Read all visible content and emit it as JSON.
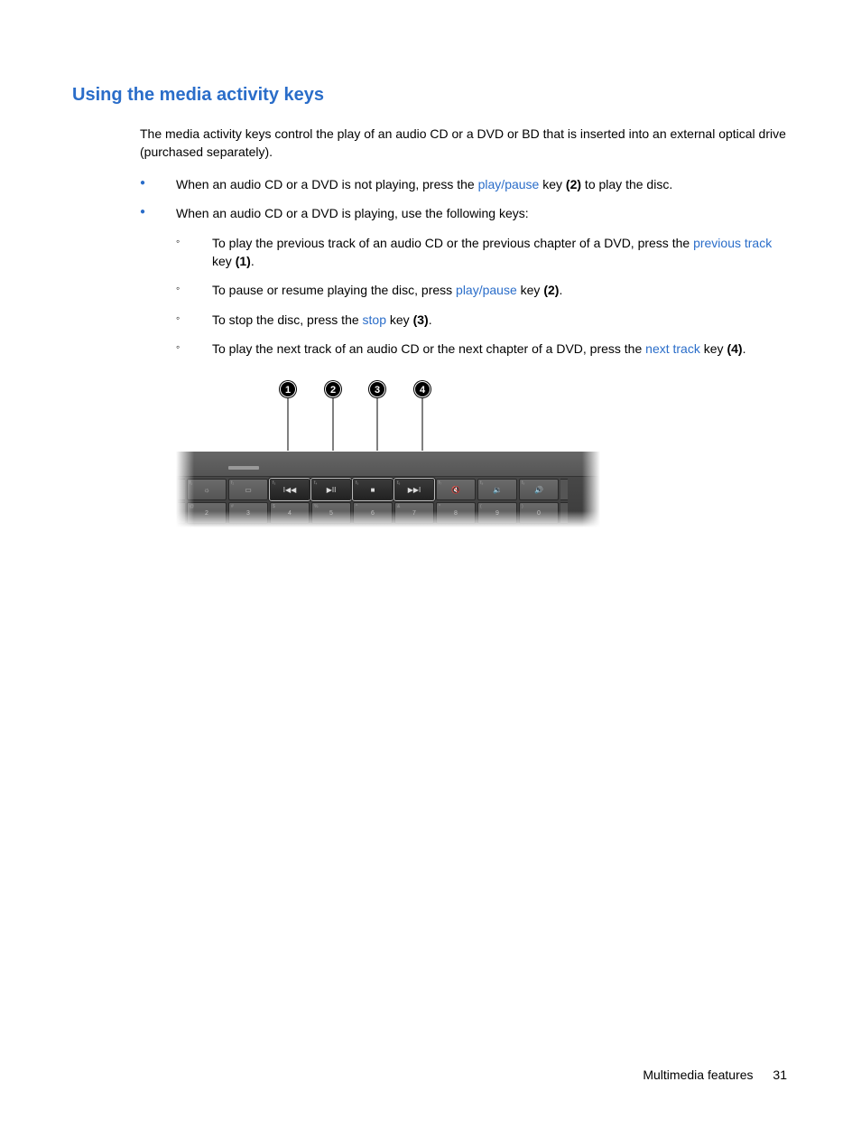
{
  "heading": "Using the media activity keys",
  "intro": "The media activity keys control the play of an audio CD or a DVD or BD that is inserted into an external optical drive (purchased separately).",
  "bullet1": {
    "pre": "When an audio CD or a DVD is not playing, press the ",
    "link": "play/pause",
    "post_a": " key ",
    "bold": "(2)",
    "post_b": " to play the disc."
  },
  "bullet2": "When an audio CD or a DVD is playing, use the following keys:",
  "sub1": {
    "pre": "To play the previous track of an audio CD or the previous chapter of a DVD, press the ",
    "link": "previous track",
    "post_a": " key ",
    "bold": "(1)",
    "post_b": "."
  },
  "sub2": {
    "pre": "To pause or resume playing the disc, press ",
    "link": "play/pause",
    "post_a": " key ",
    "bold": "(2)",
    "post_b": "."
  },
  "sub3": {
    "pre": "To stop the disc, press the ",
    "link": "stop",
    "post_a": " key ",
    "bold": "(3)",
    "post_b": "."
  },
  "sub4": {
    "pre": "To play the next track of an audio CD or the next chapter of a DVD, press the ",
    "link": "next track",
    "post_a": " key ",
    "bold": "(4)",
    "post_b": "."
  },
  "callouts": {
    "c1": "1",
    "c2": "2",
    "c3": "3",
    "c4": "4"
  },
  "fn_labels": {
    "f1": "f₁",
    "f2": "f₂",
    "f3": "f₃",
    "f4": "f₄",
    "f5": "f₅",
    "f6": "f₆",
    "f7": "f₇",
    "f8": "f₈",
    "f9": "f₉"
  },
  "key_glyphs": {
    "brightness_down": "☼",
    "display": "▭",
    "previous": "I◀◀",
    "playpause": "▶II",
    "stop": "■",
    "next": "▶▶I",
    "mute": "🔇",
    "voldown": "🔉",
    "volup": "🔊"
  },
  "num_row": {
    "k2": {
      "top": "@",
      "main": "2"
    },
    "k3": {
      "top": "#",
      "main": "3"
    },
    "k4": {
      "top": "$",
      "main": "4"
    },
    "k5": {
      "top": "%",
      "main": "5"
    },
    "k6": {
      "top": "^",
      "main": "6"
    },
    "k7": {
      "top": "&",
      "main": "7"
    },
    "k8": {
      "top": "*",
      "main": "8"
    },
    "k9": {
      "top": "(",
      "main": "9"
    },
    "k0": {
      "top": ")",
      "main": "0"
    }
  },
  "footer": {
    "section": "Multimedia features",
    "page": "31"
  }
}
